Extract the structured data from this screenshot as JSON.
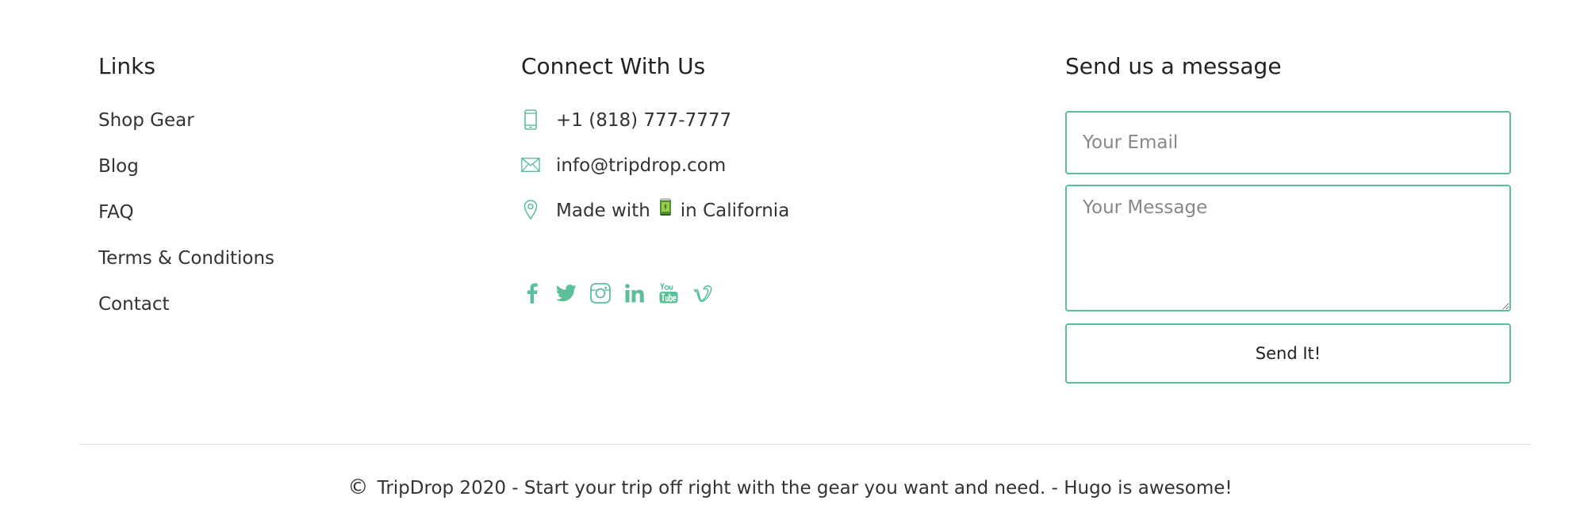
{
  "links": {
    "title": "Links",
    "items": [
      {
        "label": "Shop Gear"
      },
      {
        "label": "Blog"
      },
      {
        "label": "FAQ"
      },
      {
        "label": "Terms & Conditions"
      },
      {
        "label": "Contact"
      }
    ]
  },
  "connect": {
    "title": "Connect With Us",
    "phone": {
      "icon": "phone-icon",
      "text": "+1 (818) 777-7777"
    },
    "email": {
      "icon": "envelope-icon",
      "text": "info@tripdrop.com"
    },
    "location": {
      "icon": "map-pin-icon",
      "text_before": "Made with",
      "emoji": "beverage-can-icon",
      "text_after": "in California"
    },
    "social": [
      {
        "name": "facebook-icon"
      },
      {
        "name": "twitter-icon"
      },
      {
        "name": "instagram-icon"
      },
      {
        "name": "linkedin-icon"
      },
      {
        "name": "youtube-icon"
      },
      {
        "name": "vimeo-icon"
      }
    ]
  },
  "message": {
    "title": "Send us a message",
    "email_placeholder": "Your Email",
    "email_value": "",
    "message_placeholder": "Your Message",
    "message_value": "",
    "send_label": "Send It!"
  },
  "footer": {
    "copyright_symbol": "©",
    "copyright_text": "TripDrop 2020 - Start your trip off right with the gear you want and need. - Hugo is awesome!"
  },
  "colors": {
    "accent": "#5bbf98",
    "text": "#333333",
    "placeholder": "#888888",
    "divider": "#dddddd"
  }
}
